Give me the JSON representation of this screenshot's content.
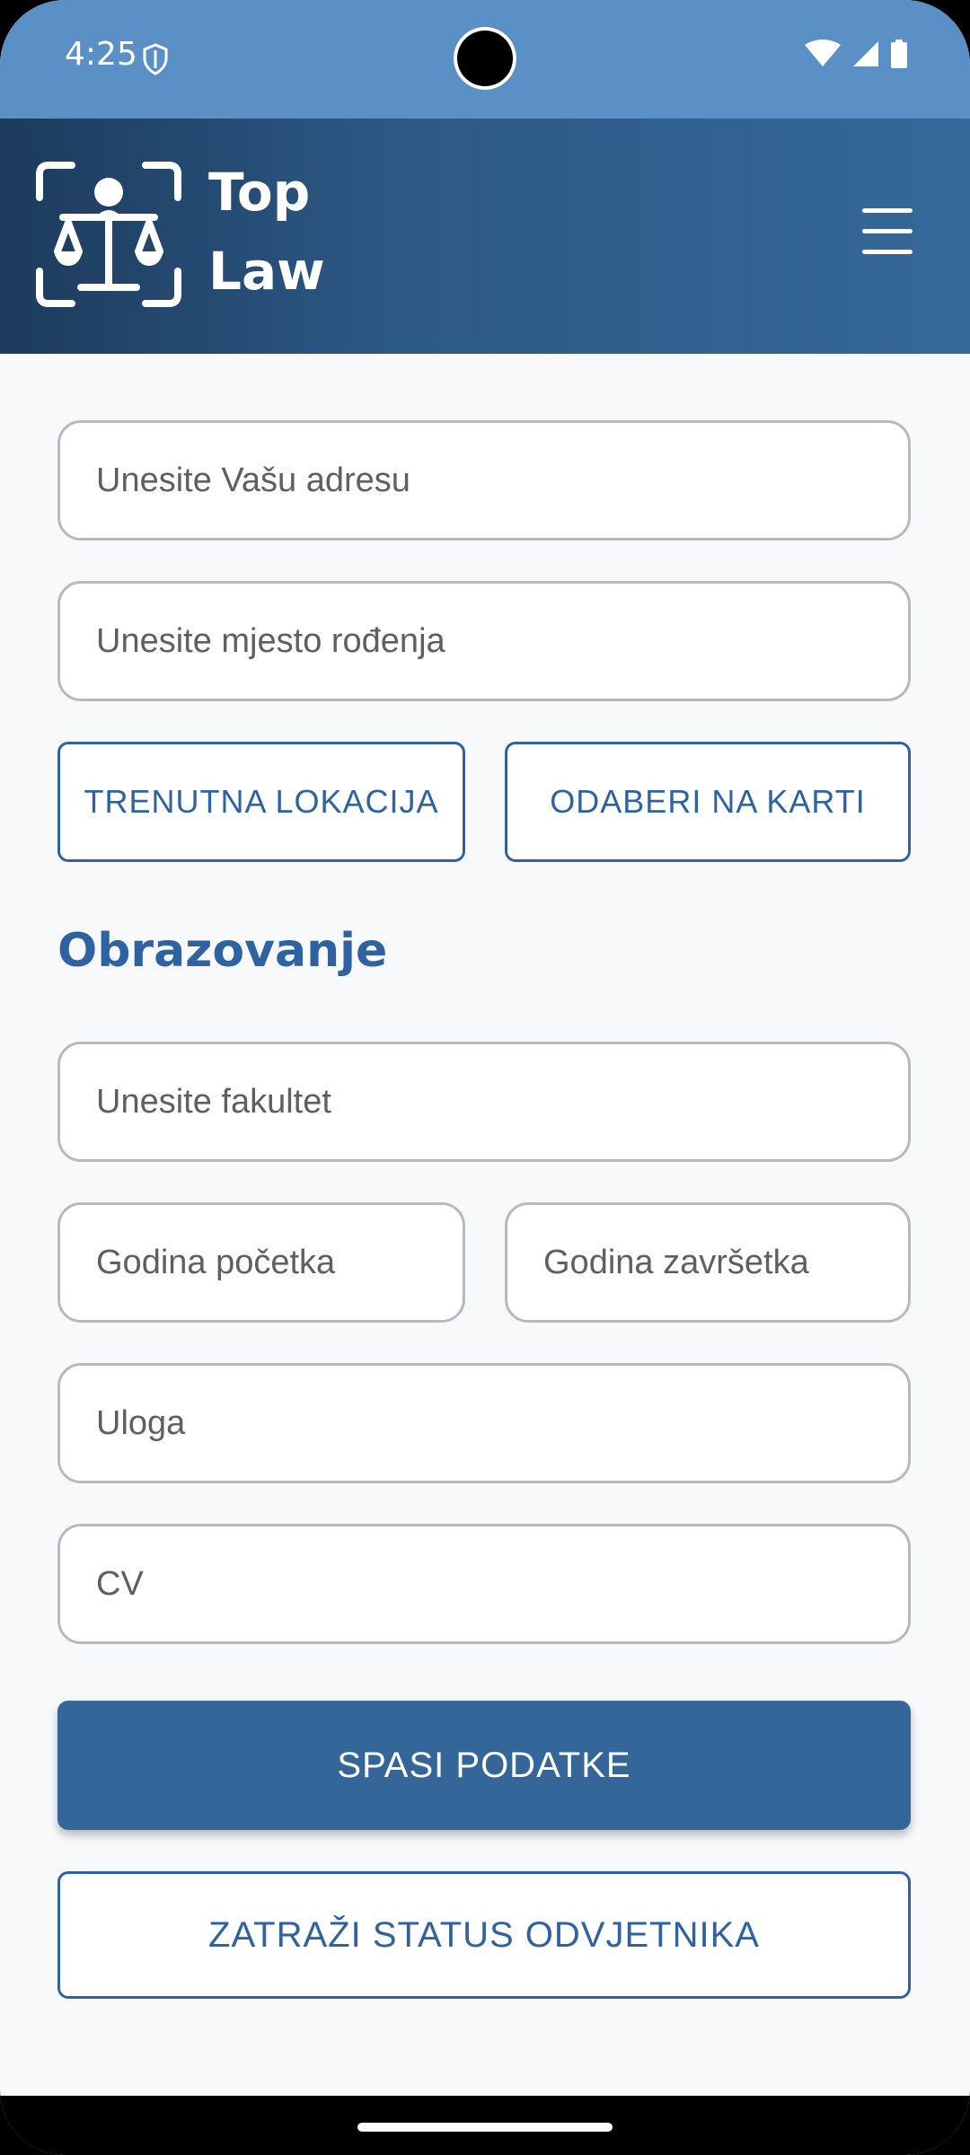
{
  "status_bar": {
    "time": "4:25"
  },
  "app_bar": {
    "title_line1": "Top",
    "title_line2": "Law"
  },
  "form": {
    "address_placeholder": "Unesite Vašu adresu",
    "birthplace_placeholder": "Unesite mjesto rođenja",
    "current_location_button": "TRENUTNA LOKACIJA",
    "pick_on_map_button": "ODABERI NA KARTI",
    "education_title": "Obrazovanje",
    "faculty_placeholder": "Unesite fakultet",
    "start_year_placeholder": "Godina početka",
    "end_year_placeholder": "Godina završetka",
    "role_placeholder": "Uloga",
    "cv_placeholder": "CV",
    "save_button": "SPASI PODATKE",
    "request_status_button": "ZATRAŽI STATUS ODVJETNIKA"
  },
  "colors": {
    "status_bar": "#5b90c6",
    "app_bar_start": "#1d3b5c",
    "app_bar_end": "#356999",
    "accent": "#2f62a0",
    "primary_button": "#346699",
    "background": "#f8f9fb"
  }
}
